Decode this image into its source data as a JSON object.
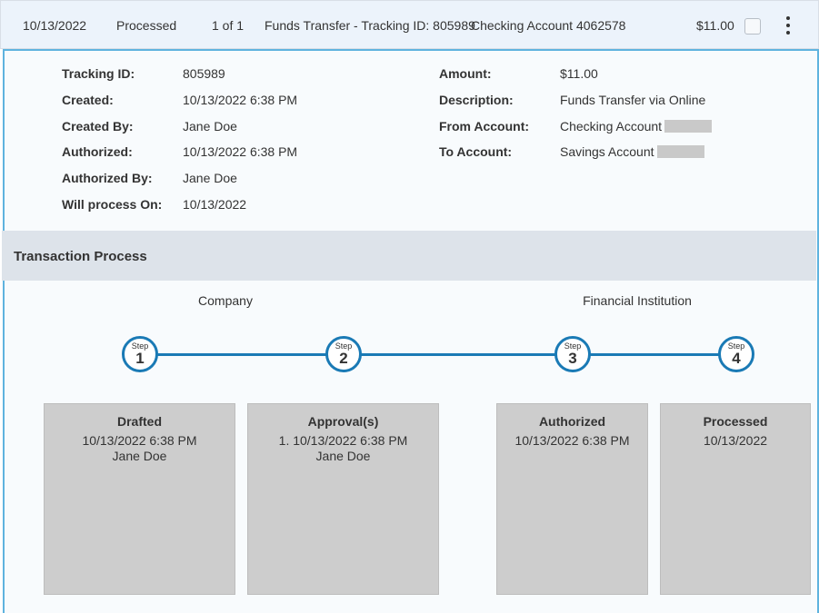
{
  "row": {
    "date": "10/13/2022",
    "status": "Processed",
    "count": "1 of 1",
    "description": "Funds Transfer - Tracking ID: 805989",
    "account": "Checking Account 4062578",
    "amount": "$11.00"
  },
  "details": {
    "left": [
      {
        "label": "Tracking ID:",
        "value": "805989"
      },
      {
        "label": "Created:",
        "value": "10/13/2022 6:38 PM"
      },
      {
        "label": "Created By:",
        "value": "Jane Doe"
      },
      {
        "label": "Authorized:",
        "value": "10/13/2022 6:38 PM"
      },
      {
        "label": "Authorized By:",
        "value": "Jane Doe"
      },
      {
        "label": "Will process On:",
        "value": "10/13/2022"
      }
    ],
    "right": [
      {
        "label": "Amount:",
        "value": "$11.00"
      },
      {
        "label": "Description:",
        "value": "Funds Transfer via Online"
      },
      {
        "label": "From Account:",
        "value": "Checking Account"
      },
      {
        "label": "To Account:",
        "value": "Savings Account"
      }
    ]
  },
  "process": {
    "title": "Transaction Process",
    "groups": [
      "Company",
      "Financial Institution"
    ],
    "step_word": "Step",
    "steps": [
      {
        "number": "1",
        "title": "Drafted",
        "lines": [
          "10/13/2022 6:38 PM",
          "Jane Doe"
        ]
      },
      {
        "number": "2",
        "title": "Approval(s)",
        "lines": [
          "1. 10/13/2022 6:38 PM",
          "Jane Doe"
        ]
      },
      {
        "number": "3",
        "title": "Authorized",
        "lines": [
          "10/13/2022 6:38 PM"
        ]
      },
      {
        "number": "4",
        "title": "Processed",
        "lines": [
          "10/13/2022"
        ]
      }
    ]
  },
  "icons": {
    "row_checkbox": "checkbox-icon",
    "row_menu": "kebab-menu-icon"
  },
  "colors": {
    "accent": "#1a7ab5",
    "panel_border": "#5fb3df",
    "header_bg": "#ecf3fb",
    "section_bg": "#dde3ea",
    "card_bg": "#cdcdcd"
  }
}
